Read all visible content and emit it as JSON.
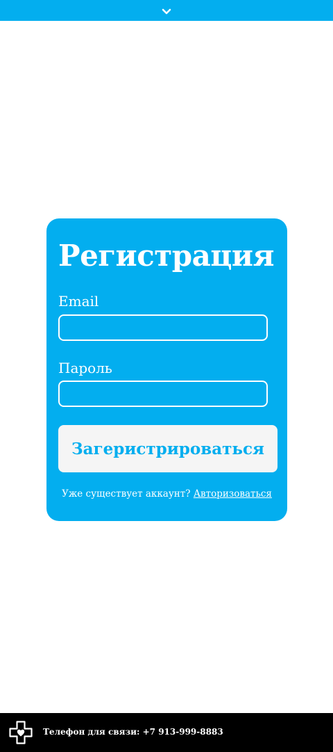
{
  "top_bar": {
    "toggle_icon": "chevron-down-icon",
    "color": "#03aeef"
  },
  "register_form": {
    "title": "Регистрация",
    "email_label": "Email",
    "email_value": "",
    "password_label": "Пароль",
    "password_value": "",
    "submit_label": "Загеристрироваться",
    "login_prompt": "Уже существует аккаунт?",
    "login_link": "Авторизоваться",
    "accent_color": "#03aeef"
  },
  "footer": {
    "logo_icon": "medical-cross-heart-icon",
    "phone_text": "Телефон для связи: +7 913-999-8883"
  }
}
